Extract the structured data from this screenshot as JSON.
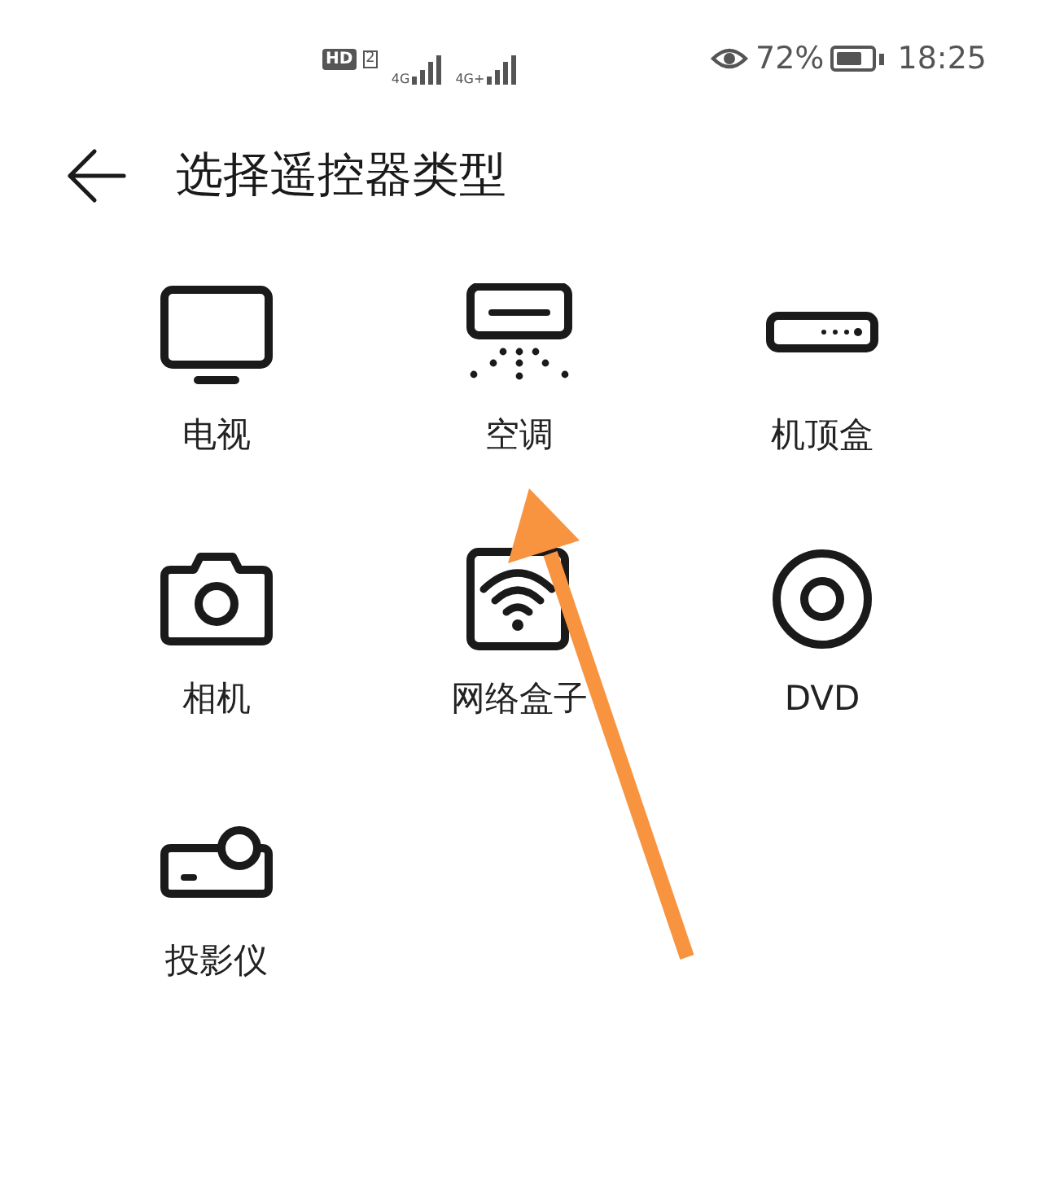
{
  "status_bar": {
    "hd": "HD",
    "sim": "2",
    "networks": [
      "4G",
      "4G+"
    ],
    "battery_percent": "72%",
    "time": "18:25"
  },
  "header": {
    "title": "选择遥控器类型"
  },
  "devices": [
    {
      "kind": "tv",
      "label": "电视"
    },
    {
      "kind": "ac",
      "label": "空调"
    },
    {
      "kind": "stb",
      "label": "机顶盒"
    },
    {
      "kind": "camera",
      "label": "相机"
    },
    {
      "kind": "wifibox",
      "label": "网络盒子"
    },
    {
      "kind": "disc",
      "label": "DVD"
    },
    {
      "kind": "projector",
      "label": "投影仪"
    }
  ],
  "annotation": {
    "kind": "arrow",
    "color": "#f89440"
  }
}
